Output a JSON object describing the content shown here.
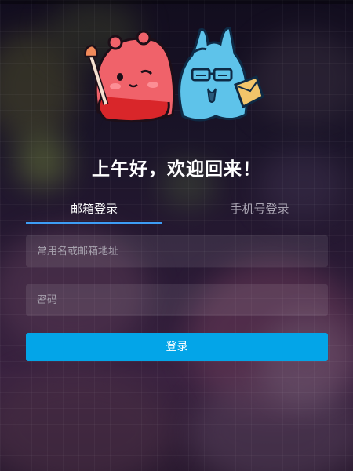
{
  "greeting": "上午好，欢迎回来！",
  "tabs": [
    {
      "label": "邮箱登录",
      "active": true
    },
    {
      "label": "手机号登录",
      "active": false
    }
  ],
  "email_field": {
    "placeholder": "常用名或邮箱地址",
    "value": ""
  },
  "password_field": {
    "placeholder": "密码",
    "value": ""
  },
  "login_button": {
    "label": "登录"
  },
  "colors": {
    "accent_button": "#03a5e8",
    "tab_underline": "#3d9df5",
    "mascot_pink": "#f0626a",
    "mascot_blue": "#5ec3ea"
  },
  "icons": [
    "pink-mascot-with-brush",
    "blue-mascot-with-envelope"
  ]
}
